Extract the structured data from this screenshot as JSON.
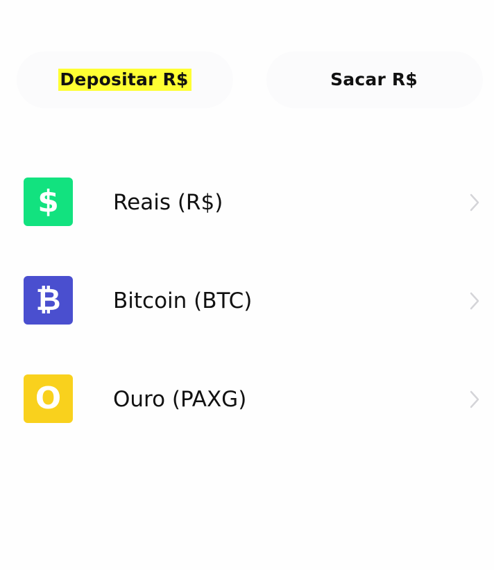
{
  "tabs": {
    "deposit_label": "Depositar R$",
    "withdraw_label": "Sacar R$"
  },
  "assets": [
    {
      "label": "Reais (R$)",
      "icon_name": "dollar-icon",
      "icon_glyph": "$",
      "icon_color": "#12e27f"
    },
    {
      "label": "Bitcoin (BTC)",
      "icon_name": "bitcoin-icon",
      "icon_glyph": "₿",
      "icon_color": "#4a4fcf"
    },
    {
      "label": "Ouro (PAXG)",
      "icon_name": "gold-icon",
      "icon_glyph": "O",
      "icon_color": "#f9d11d"
    }
  ],
  "colors": {
    "highlight": "#ffff33",
    "button_background": "#fbfbfc",
    "chevron": "#d4d4d8"
  }
}
